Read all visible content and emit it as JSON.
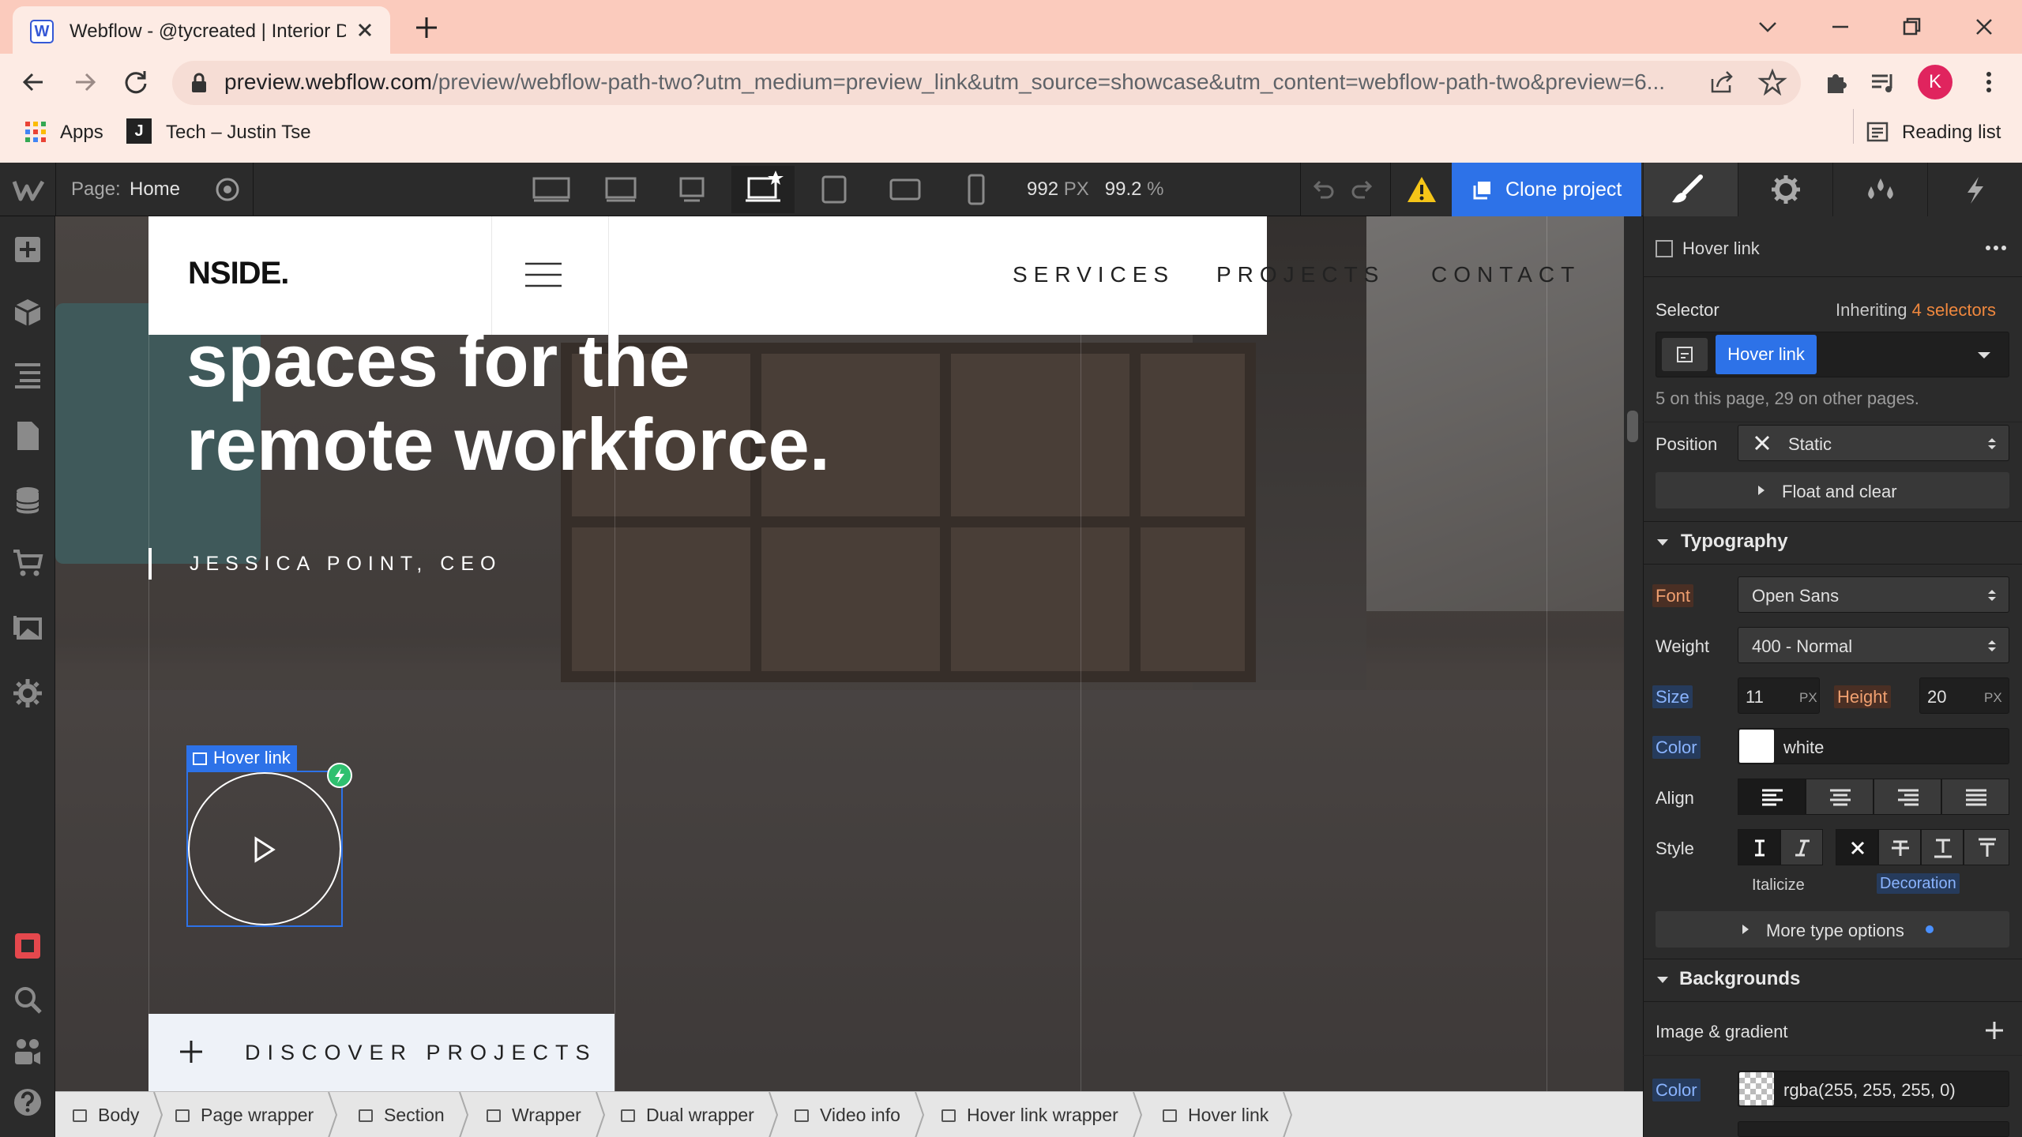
{
  "browser": {
    "tab_title": "Webflow - @tycreated | Interior D",
    "tab_favicon": "W",
    "url_host": "preview.webflow.com",
    "url_path": "/preview/webflow-path-two?utm_medium=preview_link&utm_source=showcase&utm_content=webflow-path-two&preview=6...",
    "bookmarks": [
      {
        "label": "Apps",
        "icon": "apps-grid-icon"
      },
      {
        "label": "Tech – Justin Tse",
        "icon": "bookmark-favicon-icon"
      }
    ],
    "reading_list": "Reading list",
    "profile_initial": "K",
    "colors": {
      "tabstrip": "#fbcbbd",
      "toolbar": "#fdebe4",
      "profile": "#e0245e"
    }
  },
  "designer": {
    "page_label": "Page:",
    "page_value": "Home",
    "canvas_width": "992",
    "canvas_width_unit": "PX",
    "zoom": "99.2",
    "zoom_unit": "%",
    "clone_label": "Clone project",
    "accent": "#2d72e8"
  },
  "site": {
    "logo": "NSIDE.",
    "nav": [
      "SERVICES",
      "PROJECTS",
      "CONTACT"
    ],
    "hero_line1": "spaces for the",
    "hero_line2": "remote workforce.",
    "author": "JESSICA POINT, CEO",
    "selected_element_tag": "Hover link",
    "discover": "DISCOVER PROJECTS"
  },
  "breadcrumb": [
    "Body",
    "Page wrapper",
    "Section",
    "Wrapper",
    "Dual wrapper",
    "Video info",
    "Hover link wrapper",
    "Hover link"
  ],
  "panel": {
    "element_name": "Hover link",
    "selector_label": "Selector",
    "inheriting_prefix": "Inheriting",
    "inheriting_count": "4 selectors",
    "selector_chip": "Hover link",
    "selector_note": "5 on this page, 29 on other pages.",
    "position_label": "Position",
    "position_value": "Static",
    "float_label": "Float and clear",
    "typography_head": "Typography",
    "font_label": "Font",
    "font_value": "Open Sans",
    "weight_label": "Weight",
    "weight_value": "400 - Normal",
    "size_label": "Size",
    "size_value": "11",
    "size_unit": "PX",
    "height_label": "Height",
    "height_value": "20",
    "height_unit": "PX",
    "color_label": "Color",
    "color_value": "white",
    "align_label": "Align",
    "style_label": "Style",
    "italicize_label": "Italicize",
    "decoration_label": "Decoration",
    "more_type": "More type options",
    "backgrounds_head": "Backgrounds",
    "image_gradient": "Image & gradient",
    "bg_color_label": "Color",
    "bg_color_value": "rgba(255, 255, 255, 0)"
  }
}
